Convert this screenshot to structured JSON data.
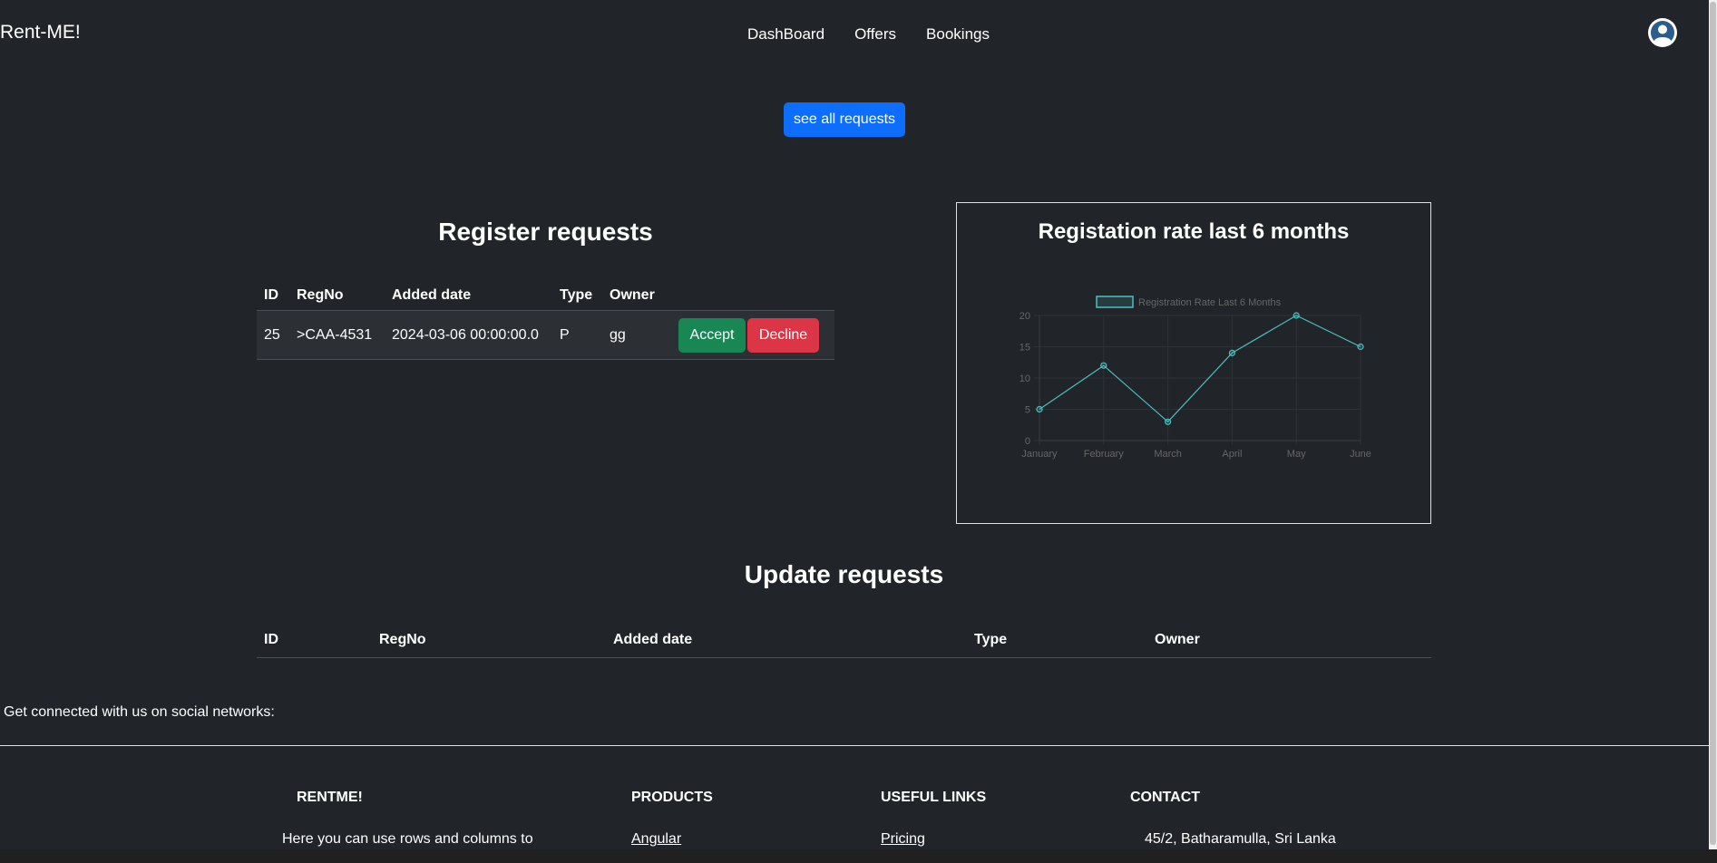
{
  "header": {
    "brand": "Rent-ME!",
    "nav": [
      "DashBoard",
      "Offers",
      "Bookings"
    ]
  },
  "actions": {
    "see_all": "see all requests"
  },
  "register": {
    "title": "Register requests",
    "columns": [
      "ID",
      "RegNo",
      "Added date",
      "Type",
      "Owner"
    ],
    "rows": [
      {
        "id": "25",
        "regno": ">CAA-4531",
        "date": "2024-03-06 00:00:00.0",
        "type": "P",
        "owner": "gg"
      }
    ],
    "accept_label": "Accept",
    "decline_label": "Decline"
  },
  "chart_card": {
    "title": "Registation rate last 6 months"
  },
  "chart_data": {
    "type": "line",
    "categories": [
      "January",
      "February",
      "March",
      "April",
      "May",
      "June"
    ],
    "series": [
      {
        "name": "Registration Rate Last 6 Months",
        "values": [
          5,
          12,
          3,
          14,
          20,
          15
        ]
      }
    ],
    "ylim": [
      0,
      20
    ],
    "yticks": [
      0,
      5,
      10,
      15,
      20
    ],
    "grid": true,
    "legend": "top",
    "colors": {
      "line": "#4bc0c0",
      "axis": "#666666",
      "grid": "#2e3236"
    }
  },
  "update": {
    "title": "Update requests",
    "columns": [
      "ID",
      "RegNo",
      "Added date",
      "Type",
      "Owner"
    ]
  },
  "footer": {
    "social": "Get connected with us on social networks:",
    "col1": {
      "heading": "RENTME!",
      "text": "Here you can use rows and columns to"
    },
    "col2": {
      "heading": "PRODUCTS",
      "link": "Angular"
    },
    "col3": {
      "heading": "USEFUL LINKS",
      "link": "Pricing"
    },
    "col4": {
      "heading": "CONTACT",
      "text": "45/2, Batharamulla, Sri Lanka"
    }
  }
}
